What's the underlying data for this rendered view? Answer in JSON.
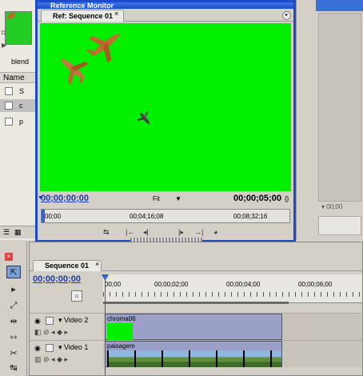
{
  "project_panel": {
    "bin_label": "blend",
    "name_header": "Name",
    "rows": [
      "S",
      "c",
      "p"
    ]
  },
  "reference_monitor": {
    "title": "Reference Monitor",
    "tab_label": "Ref: Sequence 01",
    "tab_close": "×",
    "menu_icon": "▸",
    "current_timecode": "00;00;00;00",
    "zoom_label": "Fit",
    "zoom_arrow": "▼",
    "duration": "00;00;05;00",
    "ruler_ticks": [
      "00;00",
      "00;04;16;08",
      "00;08;32;16"
    ],
    "transport_icons": [
      "loop-icon",
      "step-back-icon",
      "play-icon",
      "step-forward-icon",
      "output-icon"
    ]
  },
  "timeline": {
    "tab_label": "Sequence 01",
    "tab_close": "×",
    "current_timecode": "00;00;00;00",
    "ruler_ticks": [
      "00;00",
      "00;00;02;00",
      "00;00;04;00",
      "00;00;06;00"
    ],
    "tracks": [
      {
        "name": "Video 2",
        "clip": "chroma06"
      },
      {
        "name": "Video 1",
        "clip": "paisagem"
      }
    ]
  },
  "right_panel": {
    "timecode": "00;00"
  },
  "tools": [
    "selection-tool",
    "track-select-tool",
    "ripple-edit-tool",
    "rolling-edit-tool",
    "rate-stretch-tool",
    "razor-tool",
    "slip-tool"
  ],
  "colors": {
    "chroma_green": "#00f000",
    "window_border": "#1c4ac8",
    "timecode_blue": "#1a3aa8",
    "clip_purple": "#9aa0c8"
  }
}
